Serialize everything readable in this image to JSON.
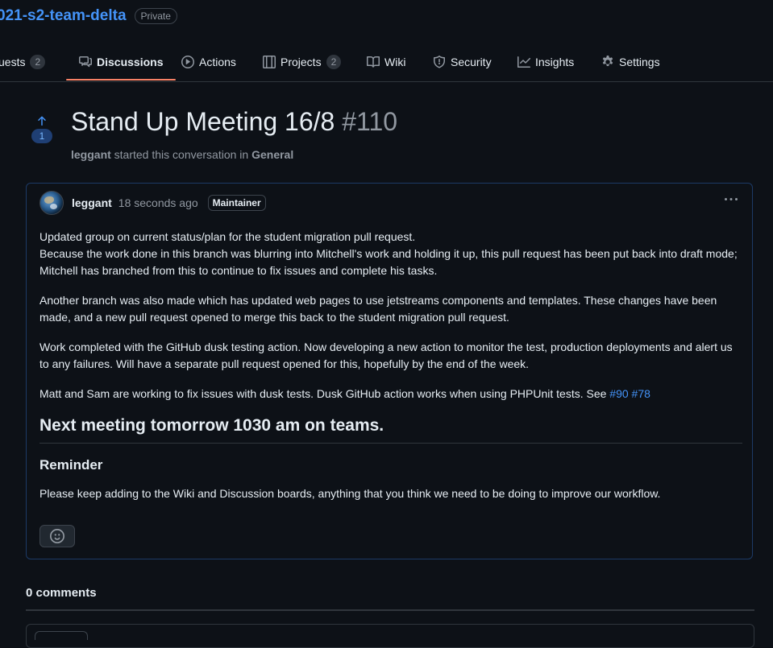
{
  "repo": {
    "name": "021-s2-team-delta",
    "visibility": "Private"
  },
  "nav": {
    "tabs": [
      {
        "label": "uests",
        "count": "2"
      },
      {
        "label": "Discussions"
      },
      {
        "label": "Actions"
      },
      {
        "label": "Projects",
        "count": "2"
      },
      {
        "label": "Wiki"
      },
      {
        "label": "Security"
      },
      {
        "label": "Insights"
      },
      {
        "label": "Settings"
      }
    ],
    "active_tab": "Discussions"
  },
  "discussion": {
    "upvotes": "1",
    "title": "Stand Up Meeting 16/8",
    "number": "#110",
    "author": "leggant",
    "started_text": "started this conversation in",
    "category": "General"
  },
  "post": {
    "author": "leggant",
    "time": "18 seconds ago",
    "role_badge": "Maintainer",
    "paragraphs": [
      "Updated group on current status/plan for the student migration pull request.",
      "Because the work done in this branch was blurring into Mitchell's work and holding it up, this pull request has been put back into draft mode; Mitchell has branched from this to continue to fix issues and complete his tasks.",
      "Another branch was also made which has updated web pages to use jetstreams components and templates. These changes have been made, and a new pull request opened to merge this back to the student migration pull request.",
      "Work completed with the GitHub dusk testing action. Now developing a new action to monitor the test, production deployments and alert us to any failures. Will have a separate pull request opened for this, hopefully by the end of the week.",
      "Matt and Sam are working to fix issues with dusk tests. Dusk GitHub action works when using PHPUnit tests. See"
    ],
    "links": [
      "#90",
      "#78"
    ],
    "heading": "Next meeting tomorrow 1030 am on teams.",
    "subheading": "Reminder",
    "reminder_text": "Please keep adding to the Wiki and Discussion boards, anything that you think we need to be doing to improve our workflow."
  },
  "comments": {
    "label": "0 comments"
  }
}
